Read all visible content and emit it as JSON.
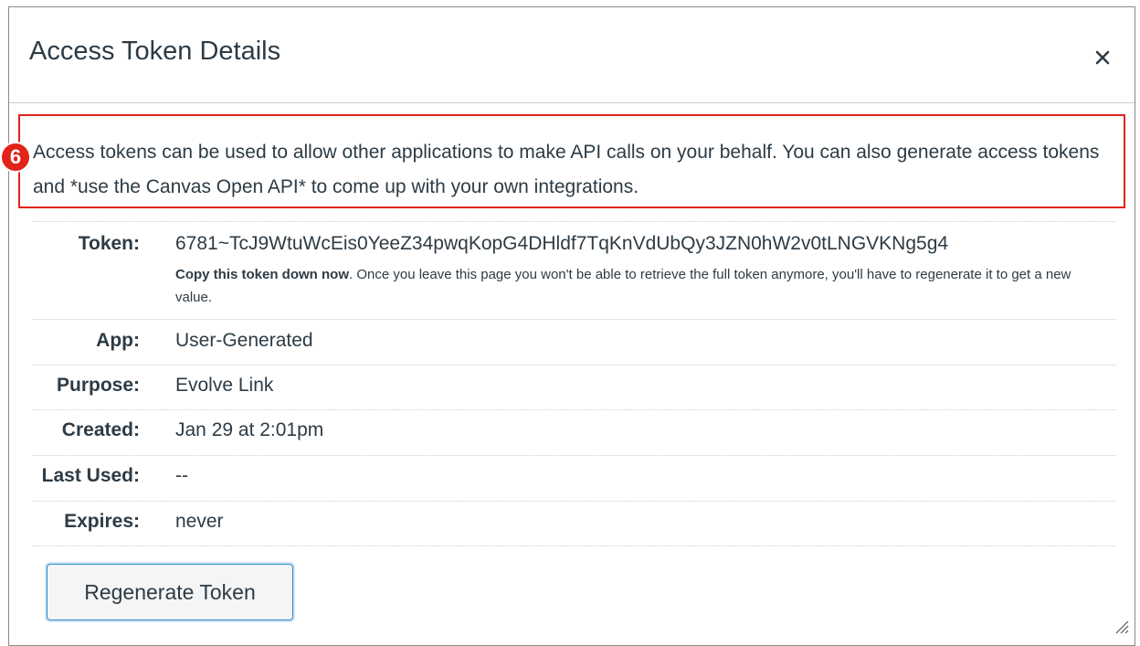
{
  "dialog": {
    "title": "Access Token Details",
    "close_label": "×"
  },
  "callout": {
    "badge": "6",
    "intro": "Access tokens can be used to allow other applications to make API calls on your behalf. You can also generate access tokens and *use the Canvas Open API* to come up with your own integrations."
  },
  "details": {
    "token": {
      "label": "Token:",
      "value": "6781~TcJ9WtuWcEis0YeeZ34pwqKopG4DHldf7TqKnVdUbQy3JZN0hW2v0tLNGVKNg5g4",
      "note_bold": "Copy this token down now",
      "note_rest": ". Once you leave this page you won't be able to retrieve the full token anymore, you'll have to regenerate it to get a new value."
    },
    "app": {
      "label": "App:",
      "value": "User-Generated"
    },
    "purpose": {
      "label": "Purpose:",
      "value": "Evolve Link"
    },
    "created": {
      "label": "Created:",
      "value": "Jan 29 at 2:01pm"
    },
    "last_used": {
      "label": "Last Used:",
      "value": "--"
    },
    "expires": {
      "label": "Expires:",
      "value": "never"
    }
  },
  "actions": {
    "regenerate_label": "Regenerate Token"
  }
}
